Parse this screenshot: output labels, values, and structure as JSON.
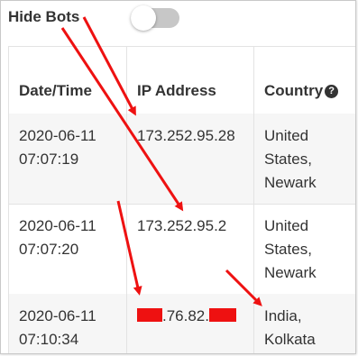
{
  "toolbar": {
    "hide_bots_label": "Hide Bots",
    "hide_bots_enabled": false
  },
  "table": {
    "columns": [
      "Date/Time",
      "IP Address",
      "Country"
    ],
    "country_help_icon": "question-circle-icon",
    "rows": [
      {
        "date": "2020-06-11",
        "time": "07:07:19",
        "ip": "173.252.95.28",
        "country_lines": [
          "United",
          "States,",
          "Newark"
        ]
      },
      {
        "date": "2020-06-11",
        "time": "07:07:20",
        "ip": "173.252.95.2",
        "country_lines": [
          "United",
          "States,",
          "Newark"
        ]
      },
      {
        "date": "2020-06-11",
        "time": "07:10:34",
        "ip_visible": ".76.82.",
        "country_lines": [
          "India,",
          "Kolkata"
        ]
      }
    ]
  },
  "annotation_color": "#ee1111"
}
